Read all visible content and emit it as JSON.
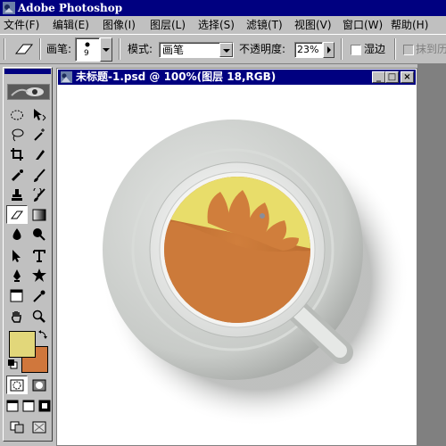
{
  "app": {
    "title": "Adobe Photoshop",
    "menu": [
      "文件(F)",
      "编辑(E)",
      "图像(I)",
      "图层(L)",
      "选择(S)",
      "滤镜(T)",
      "视图(V)",
      "窗口(W)",
      "帮助(H)"
    ]
  },
  "options_bar": {
    "brush_label": "画笔:",
    "brush_size": "9",
    "mode_label": "模式:",
    "mode_value": "画笔",
    "opacity_label": "不透明度:",
    "opacity_value": "23%",
    "wet_edges_label": "湿边",
    "erase_history_label": "抹到历"
  },
  "toolbox": {
    "tools": [
      "marquee-tool",
      "move-tool",
      "lasso-tool",
      "magic-wand-tool",
      "crop-tool",
      "slice-tool",
      "healing-brush-tool",
      "brush-tool",
      "clone-stamp-tool",
      "history-brush-tool",
      "eraser-tool",
      "gradient-tool",
      "blur-tool",
      "dodge-tool",
      "path-selection-tool",
      "type-tool",
      "pen-tool",
      "shape-tool",
      "notes-tool",
      "eyedropper-tool",
      "hand-tool",
      "zoom-tool"
    ],
    "foreground_color": "#e2d77a",
    "background_color": "#d0773c"
  },
  "document": {
    "title": "未标题-1.psd @ 100%(图层 18,RGB)",
    "buttons": [
      "_",
      "□",
      "×"
    ]
  },
  "colors": {
    "title_bar": "#000080",
    "chrome": "#c0c0c0",
    "tea": "#cc7a3a",
    "lemon": "#e8dd6a",
    "saucer": "#c8cbc8"
  }
}
